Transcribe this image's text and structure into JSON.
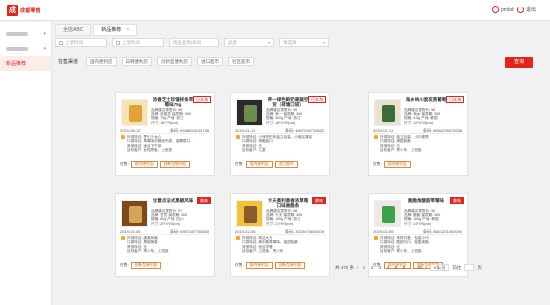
{
  "brand": {
    "name": "成都零售",
    "mark": "成"
  },
  "user": {
    "name": "pmbd",
    "logout": "退出"
  },
  "sidebar": {
    "items": [
      {
        "label": "",
        "blurred": true
      },
      {
        "label": "",
        "blurred": true
      },
      {
        "label": "新品推荐",
        "active": true
      }
    ]
  },
  "tabs": [
    {
      "label": "全店ABC"
    },
    {
      "label": "新品推荐",
      "close": "×",
      "active": true
    }
  ],
  "filters": {
    "start_date": "上架时间",
    "end_date": "上架时间",
    "product_name": "商品名称/条码",
    "category": "品类",
    "select": "请选择"
  },
  "channels": {
    "label": "在售渠道",
    "items": [
      "国内便利店",
      "日韩便利店",
      "创新型便利店",
      "进口超市",
      "社区超市"
    ]
  },
  "query_button": "查询",
  "cards": [
    {
      "name": "浓香芝士珍馐样条草莓味75g",
      "badge": "日本海",
      "badge_solid": false,
      "barcode_label": "品牌建议零售价:",
      "price": "¥8",
      "info": [
        "品牌: 浓香芝 保质期: 360",
        "规格: 75g 产地: 浙江",
        "尺寸: 16*7*5(cm)"
      ],
      "date": "2019-05-12",
      "code": "条码: 6948050104748",
      "desc": [
        "外观特征: 梦幻少女心",
        "口感特征: 草莓味浓郁而不甜，香糯顺口…",
        "其他特征: 适合下午茶",
        "目标客户: 女性顾客、上班族"
      ],
      "store_label": "在售:",
      "stores": [
        "国内便利店",
        "创新型便利店"
      ]
    },
    {
      "name": "养一绿色鲜奶果蔬空货（荷塘口袋）",
      "badge": "日本海",
      "badge_solid": false,
      "barcode_label": "品牌建议零售价:",
      "price": "¥8",
      "info": [
        "品牌: 养一 保质期: 365",
        "规格: 400g 产地: 浙江",
        "尺寸: 18*4*20(cm)"
      ],
      "date": "2019-01-11",
      "code": "条码: 4897030710622",
      "desc": [
        "外观特征: 小熊饼形状独立包装、小朋友喜欢",
        "口感特征: 清脆爽口",
        "其他特征: 无",
        "目标客户: 儿童"
      ],
      "store_label": "在售:",
      "stores": [
        "国内便利店",
        "进口超市"
      ]
    },
    {
      "name": "海乡林川瓷炭黑葡萄",
      "badge": "日本海",
      "badge_solid": false,
      "barcode_label": "品牌建议零售价:",
      "price": "¥8",
      "info": [
        "品牌: 海乡 保质期: 365",
        "规格: 4.5g 产地: 韩国",
        "尺寸: 12*6*15(cm)"
      ],
      "date": "2019-01-11",
      "code": "条码: 8944299379338",
      "desc": [
        "外观特征: 独立包装、小巧便携",
        "口感特征: 清甜爽脆",
        "其他特征: 无",
        "目标客户: 青少年、上班族"
      ],
      "store_label": "在售:",
      "stores": [
        "国内便利店"
      ]
    },
    {
      "name": "甘意点法式黑椒风味",
      "badge": "美味",
      "badge_solid": true,
      "barcode_label": "品牌建议零售价:",
      "price": "¥7",
      "info": [
        "品牌: 甘意 保质期: 365",
        "规格: 80g 产地: 四川",
        "尺寸: 20*4*20(cm)"
      ],
      "date": "2019-02-05",
      "code": "条码: 6957287768830",
      "desc": [
        "外观特征: 细美风格",
        "口感特征: 黑椒辣香",
        "其他特征: 无",
        "目标客户: 青少年、上班族"
      ],
      "store_label": "在售:",
      "stores": [
        "创新型便利店"
      ]
    },
    {
      "name": "卡夫奥利奥香浓草莓口味香脆条",
      "badge": "美味",
      "badge_solid": true,
      "barcode_label": "品牌建议零售价:",
      "price": "¥8",
      "info": [
        "品牌: 卡夫 保质期: 365",
        "规格: 150g 产地: 浙江",
        "尺寸: 21*5*4(cm)"
      ],
      "date": "2019-02-05",
      "code": "条码: 3023470825576",
      "desc": [
        "外观特征: 简洁大方",
        "口感特征: 奥利奥草莓味，香甜松脆",
        "其他特征: 适合早餐",
        "目标客户: 上班族、青少年"
      ],
      "store_label": "在售:",
      "stores": [
        "国内便利店",
        "创新型便利店"
      ]
    },
    {
      "name": "脆脆角酸甜草莓味",
      "badge": "美味",
      "badge_solid": true,
      "barcode_label": "品牌建议零售价:",
      "price": "¥6",
      "info": [
        "品牌: 脆脆 保质期: 365",
        "规格: 160g 产地: 韩国",
        "尺寸: 14*3*6(cm)"
      ],
      "date": "2019-02-05",
      "code": "条码: 8801201000000",
      "desc": [
        "外观特征: 采样可爱、包装小巧",
        "口感特征: 酸甜可口、轻盈爽脆",
        "其他特征: 无",
        "目标客户: 青少年、上班族"
      ],
      "store_label": "在售:",
      "stores": [
        "国内便利店",
        "创新型便利店"
      ]
    }
  ],
  "pagination": {
    "total": "共 470 条",
    "prev": "‹",
    "pages": [
      "1",
      "2",
      "3",
      "4",
      "5",
      "6",
      "…",
      "80"
    ],
    "current": "1",
    "next": "›",
    "page_size": "6条/页",
    "goto": "前往",
    "page_unit": "页"
  },
  "colors": {
    "accent": "#e1251b",
    "secondary": "#e08a3a"
  }
}
